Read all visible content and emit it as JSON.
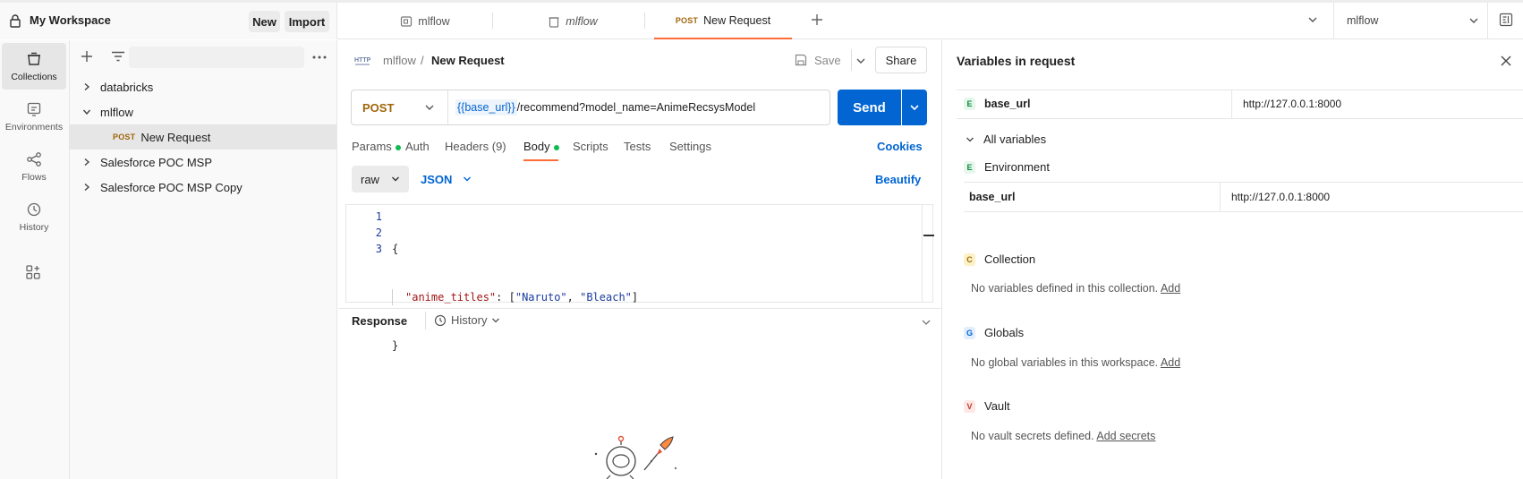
{
  "workspace": {
    "name": "My Workspace",
    "new_label": "New",
    "import_label": "Import"
  },
  "tabs": [
    {
      "label": "mlflow"
    },
    {
      "label": "mlflow"
    },
    {
      "method": "POST",
      "label": "New Request"
    }
  ],
  "env_selector": "mlflow",
  "rail": [
    {
      "label": "Collections"
    },
    {
      "label": "Environments"
    },
    {
      "label": "Flows"
    },
    {
      "label": "History"
    }
  ],
  "tree": [
    {
      "label": "databricks"
    },
    {
      "label": "mlflow"
    },
    {
      "method": "POST",
      "label": "New Request"
    },
    {
      "label": "Salesforce POC MSP"
    },
    {
      "label": "Salesforce POC MSP Copy"
    }
  ],
  "request": {
    "breadcrumb_parent": "mlflow",
    "breadcrumb_sep": "/",
    "breadcrumb_name": "New Request",
    "save_label": "Save",
    "share_label": "Share",
    "method": "POST",
    "url_var": "{{base_url}}",
    "url_path": " /recommend?model_name=AnimeRecsysModel",
    "send_label": "Send",
    "tabs": [
      "Params",
      "Auth",
      "Headers (9)",
      "Body",
      "Scripts",
      "Tests",
      "Settings"
    ],
    "cookies_label": "Cookies",
    "body_mode": "raw",
    "body_type": "JSON",
    "beautify_label": "Beautify",
    "code": {
      "line1": "{",
      "key": "\"anime_titles\"",
      "colon": ": [",
      "v1": "\"Naruto\"",
      "comma": ", ",
      "v2": "\"Bleach\"",
      "end": "]",
      "line3": "}"
    },
    "line_numbers": [
      "1",
      "2",
      "3"
    ]
  },
  "response": {
    "title": "Response",
    "history_label": "History"
  },
  "variables": {
    "title": "Variables in request",
    "top_var": {
      "badge": "E",
      "name": "base_url",
      "value": "http://127.0.0.1:8000"
    },
    "all_label": "All variables",
    "environment": {
      "badge": "E",
      "label": "Environment",
      "var_name": "base_url",
      "var_value": "http://127.0.0.1:8000"
    },
    "collection": {
      "badge": "C",
      "label": "Collection",
      "empty": "No variables defined in this collection.",
      "add": "Add"
    },
    "globals": {
      "badge": "G",
      "label": "Globals",
      "empty": "No global variables in this workspace.",
      "add": "Add"
    },
    "vault": {
      "badge": "V",
      "label": "Vault",
      "empty": "No vault secrets defined.",
      "add": "Add secrets"
    }
  },
  "colors": {
    "accent": "#0265d2",
    "method_post": "#a0660b",
    "tab_underline": "#ff6c37",
    "env_badge": "#0cbb52"
  }
}
